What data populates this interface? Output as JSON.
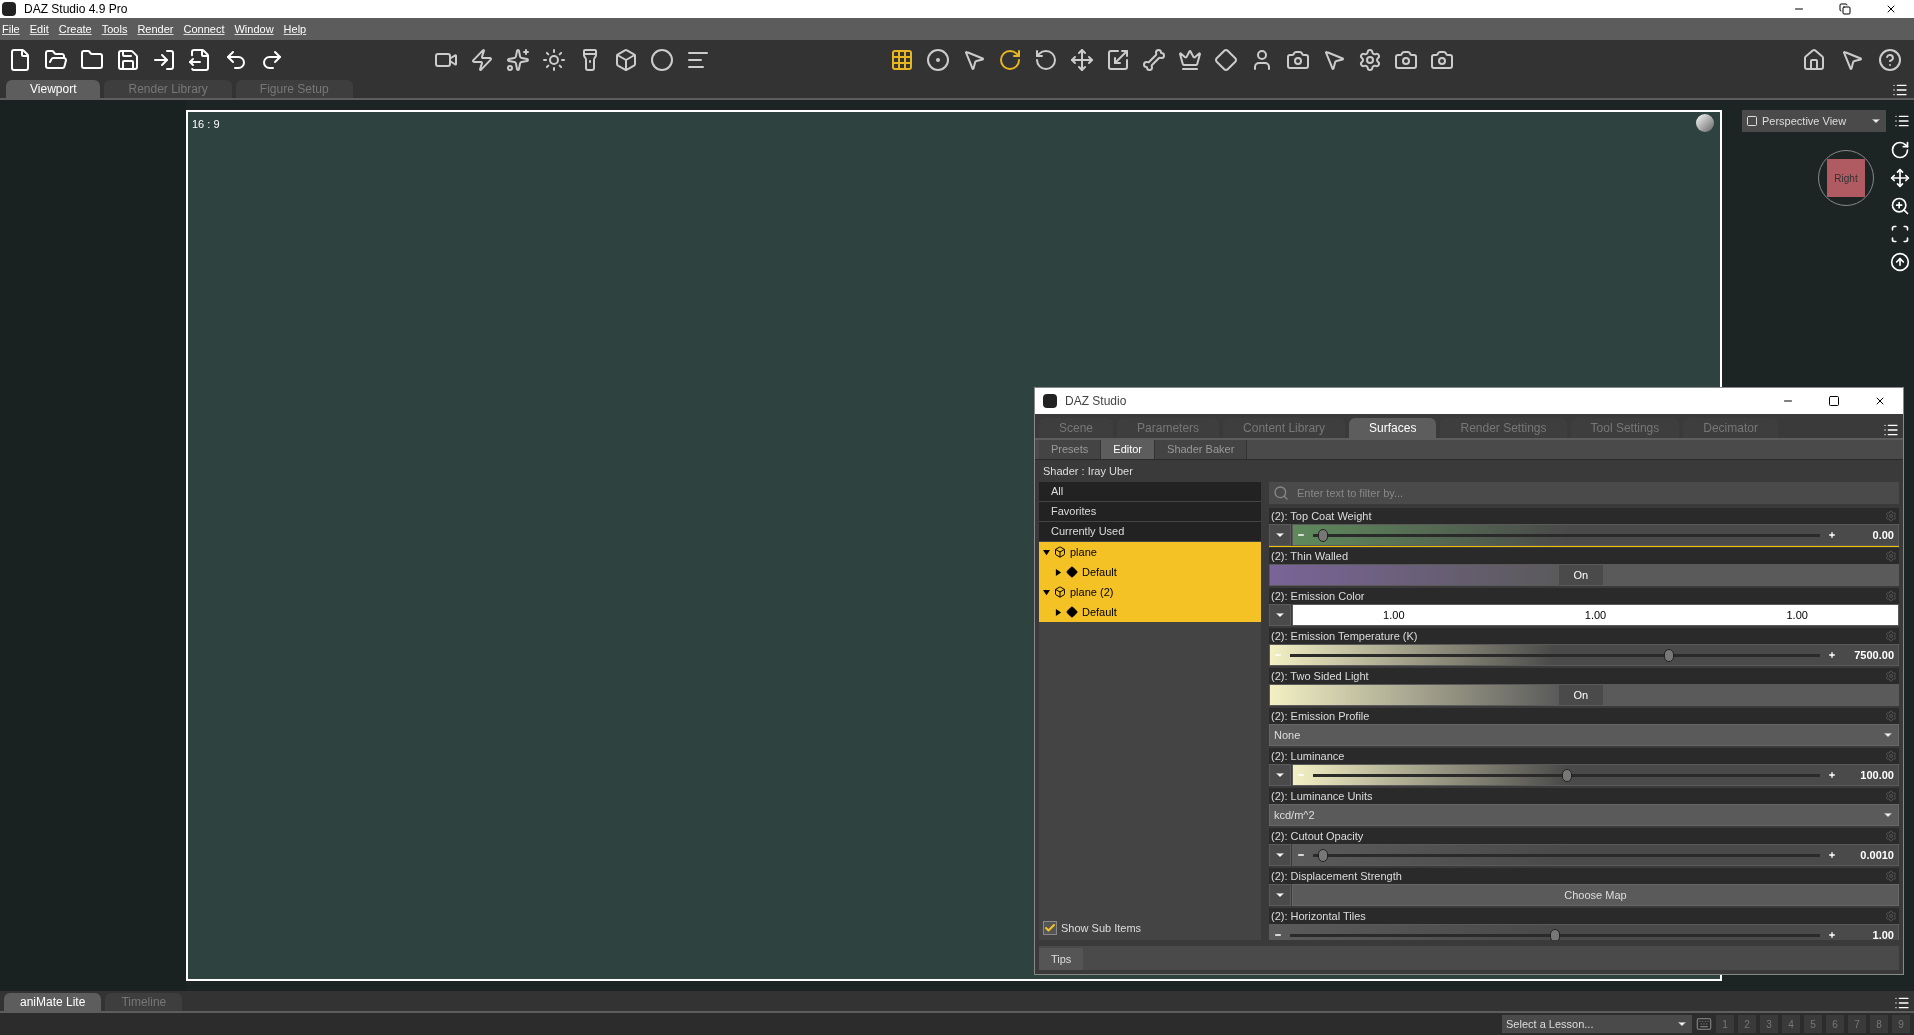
{
  "window": {
    "title": "DAZ Studio 4.9 Pro"
  },
  "menu": [
    "File",
    "Edit",
    "Create",
    "Tools",
    "Render",
    "Connect",
    "Window",
    "Help"
  ],
  "main_tabs": [
    {
      "label": "Viewport",
      "selected": true
    },
    {
      "label": "Render Library",
      "selected": false
    },
    {
      "label": "Figure Setup",
      "selected": false
    }
  ],
  "viewport": {
    "aspect_label": "16 : 9",
    "view_dropdown": "Perspective View",
    "cube_label": "Right"
  },
  "surfaces_window": {
    "title": "DAZ Studio",
    "tabs": [
      {
        "label": "Scene",
        "selected": false
      },
      {
        "label": "Parameters",
        "selected": false
      },
      {
        "label": "Content Library",
        "selected": false
      },
      {
        "label": "Surfaces",
        "selected": true
      },
      {
        "label": "Render Settings",
        "selected": false
      },
      {
        "label": "Tool Settings",
        "selected": false
      },
      {
        "label": "Decimator",
        "selected": false
      }
    ],
    "sub_tabs": [
      {
        "label": "Presets",
        "selected": false
      },
      {
        "label": "Editor",
        "selected": true
      },
      {
        "label": "Shader Baker",
        "selected": false
      }
    ],
    "shader": "Shader : Iray Uber",
    "groups": [
      "All",
      "Favorites",
      "Currently Used"
    ],
    "tree": [
      {
        "label": "plane",
        "expanded": true,
        "selected": true,
        "children": [
          {
            "label": "Default",
            "expanded": false,
            "selected": true
          }
        ]
      },
      {
        "label": "plane (2)",
        "expanded": true,
        "selected": true,
        "children": [
          {
            "label": "Default",
            "expanded": false,
            "selected": true
          }
        ]
      }
    ],
    "show_sub_items": {
      "label": "Show Sub Items",
      "checked": true
    },
    "filter_placeholder": "Enter text to filter by...",
    "properties": [
      {
        "kind": "slider",
        "label": "(2): Top Coat Weight",
        "selected": true,
        "map_button": true,
        "color": "#5f8a5c",
        "level": 0.01,
        "value": "0.00"
      },
      {
        "kind": "toggle",
        "label": "(2): Thin Walled",
        "selected": false,
        "color": "#7a6498",
        "value": "On"
      },
      {
        "kind": "color",
        "label": "(2): Emission Color",
        "selected": false,
        "map_button": true,
        "values": [
          "1.00",
          "1.00",
          "1.00"
        ]
      },
      {
        "kind": "slider",
        "label": "(2): Emission Temperature (K)",
        "selected": false,
        "map_button": false,
        "color": "#f3f0c4",
        "level": 0.72,
        "value": "7500.00"
      },
      {
        "kind": "toggle",
        "label": "(2): Two Sided Light",
        "selected": false,
        "color": "#f3f0c4",
        "value": "On"
      },
      {
        "kind": "dropdown",
        "label": "(2): Emission Profile",
        "selected": false,
        "value": "None"
      },
      {
        "kind": "slider",
        "label": "(2): Luminance",
        "selected": false,
        "map_button": true,
        "color": "#f3f0c4",
        "level": 0.5,
        "value": "100.00"
      },
      {
        "kind": "dropdown",
        "label": "(2): Luminance Units",
        "selected": false,
        "value": "kcd/m^2"
      },
      {
        "kind": "slider",
        "label": "(2): Cutout Opacity",
        "selected": false,
        "map_button": true,
        "color": "#5a5a5a",
        "level": 0.01,
        "value": "0.0010"
      },
      {
        "kind": "map",
        "label": "(2): Displacement Strength",
        "selected": false,
        "map_button": true,
        "value": "Choose Map"
      },
      {
        "kind": "slider",
        "label": "(2): Horizontal Tiles",
        "selected": false,
        "map_button": false,
        "color": "#5a5a5a",
        "level": 0.5,
        "value": "1.00"
      }
    ],
    "tips_tab": "Tips"
  },
  "bottom_tabs": [
    {
      "label": "aniMate Lite",
      "selected": true
    },
    {
      "label": "Timeline",
      "selected": false
    }
  ],
  "lesson_select": {
    "value": "Select a Lesson..."
  },
  "lesson_pages": [
    "1",
    "2",
    "3",
    "4",
    "5",
    "6",
    "7",
    "8",
    "9"
  ]
}
